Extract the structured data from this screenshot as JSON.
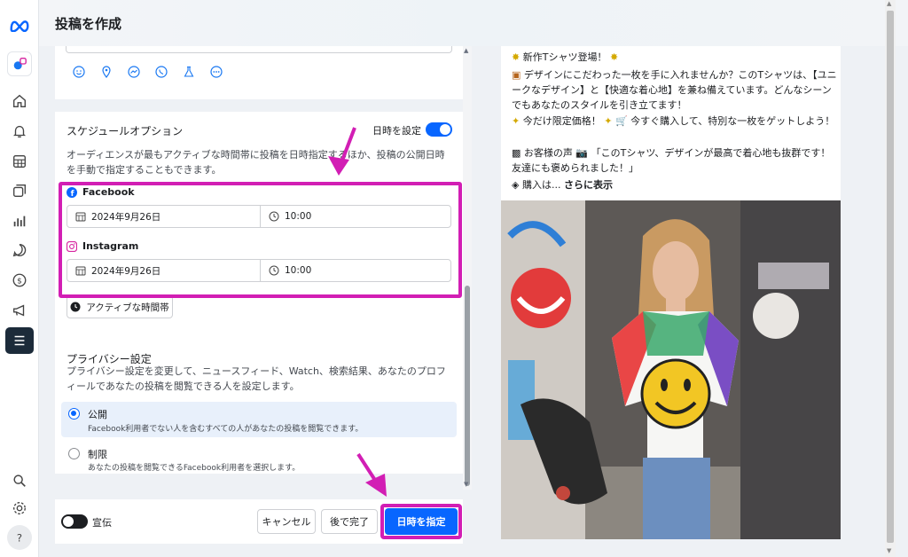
{
  "header": {
    "title": "投稿を作成"
  },
  "schedule": {
    "title": "スケジュールオプション",
    "toggle_label": "日時を設定",
    "toggle_on": true,
    "description": "オーディエンスが最もアクティブな時間帯に投稿を日時指定するほか、投稿の公開日時を手動で指定することもできます。",
    "platforms": [
      {
        "name": "Facebook",
        "date": "2024年9月26日",
        "time": "10:00"
      },
      {
        "name": "Instagram",
        "date": "2024年9月26日",
        "time": "10:00"
      }
    ],
    "active_times_button": "アクティブな時間帯"
  },
  "privacy": {
    "title": "プライバシー設定",
    "description": "プライバシー設定を変更して、ニュースフィード、Watch、検索結果、あなたのプロフィールであなたの投稿を閲覧できる人を設定します。",
    "options": [
      {
        "label": "公開",
        "sub": "Facebook利用者でない人を含むすべての人があなたの投稿を閲覧できます。",
        "selected": true
      },
      {
        "label": "制限",
        "sub": "あなたの投稿を閲覧できるFacebook利用者を選択します。",
        "selected": false
      }
    ]
  },
  "footer": {
    "boost_label": "宣伝",
    "cancel": "キャンセル",
    "later": "後で完了",
    "schedule": "日時を指定"
  },
  "preview": {
    "line1": "新作Tシャツ登場！",
    "line2": "デザインにこだわった一枚を手に入れませんか？このTシャツは、【ユニークなデザイン】と【快適な着心地】を兼ね備えています。どんなシーンでもあなたのスタイルを引き立てます！",
    "line3a": "今だけ限定価格！",
    "line3b": "今すぐ購入して、特別な一枚をゲットしよう！",
    "line4": "お客様の声 📷 「このTシャツ、デザインが最高で着心地も抜群です！友達にも褒められました！」",
    "line5a": "購入は...",
    "line5b": "さらに表示"
  },
  "colors": {
    "accent": "#0866ff",
    "highlight": "#d21eb4",
    "rail_active": "#1c2b3a"
  },
  "icons": [
    "meta-logo",
    "home-icon",
    "bell-icon",
    "calendar-grid-icon",
    "layers-icon",
    "bar-chart-icon",
    "chat-icon",
    "dollar-icon",
    "megaphone-icon",
    "menu-icon",
    "search-icon",
    "gear-icon",
    "help-icon"
  ]
}
